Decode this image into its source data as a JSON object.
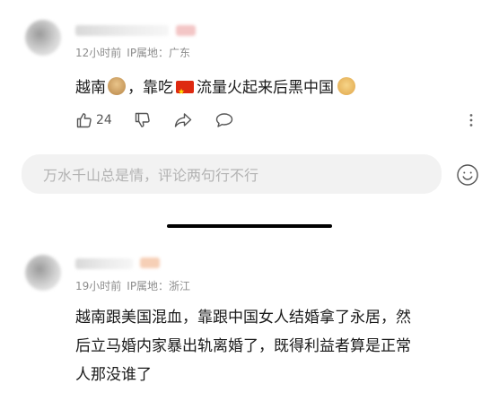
{
  "comments": [
    {
      "time": "12小时前",
      "ip_label": "IP属地：广东",
      "text_parts": [
        "越南",
        "，靠吃",
        "流量火起来后黑中国"
      ],
      "likes": "24"
    },
    {
      "time": "19小时前",
      "ip_label": "IP属地：浙江",
      "lines": [
        "越南跟美国混血，靠跟中国女人结婚拿了永居，然",
        "后立马婚内家暴出轨离婚了，既得利益者算是正常",
        "人那没谁了"
      ]
    }
  ],
  "reply_input": {
    "placeholder": "万水千山总是情，评论两句行不行"
  },
  "icons": {
    "like": "thumbs-up-icon",
    "dislike": "thumbs-down-icon",
    "share": "share-icon",
    "comment": "comment-icon",
    "more": "more-vertical-icon",
    "emoji": "smiley-icon"
  },
  "colors": {
    "icon_gray": "#555555",
    "meta_gray": "#8d8d8d",
    "input_bg": "#f2f2f2"
  }
}
